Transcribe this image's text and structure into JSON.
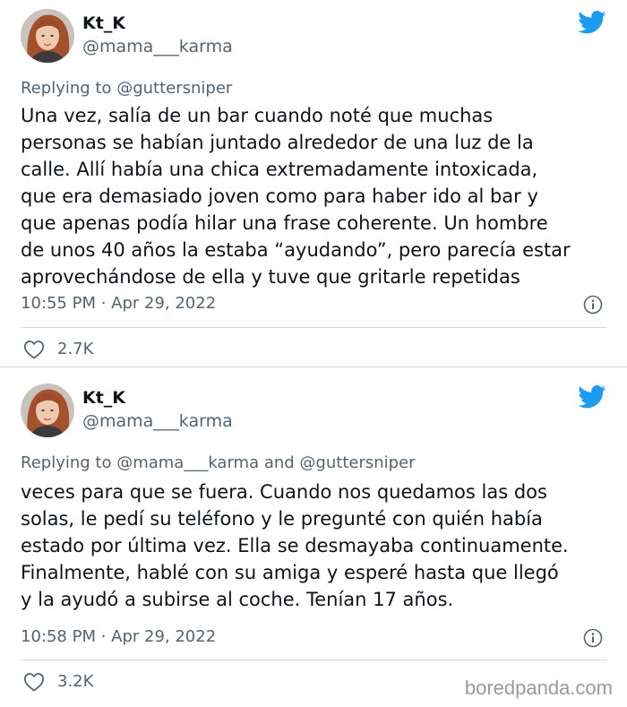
{
  "colors": {
    "text_primary": "#0f1419",
    "text_secondary": "#536471",
    "twitter_blue": "#1d9bf0",
    "divider": "#cfd9de"
  },
  "tweets": [
    {
      "author": {
        "display_name": "Kt_K",
        "handle": "@mama___karma",
        "avatar_icon": "avatar-photo"
      },
      "replying_to": "Replying to @guttersniper",
      "body_lines": [
        "Una vez, salía de un bar cuando noté que muchas",
        "personas se habían juntado alrededor de una luz de la",
        "calle. Allí había una chica extremadamente intoxicada,",
        "que era demasiado joven como para haber ido al bar y",
        "que apenas podía hilar una frase coherente. Un hombre",
        "de unos 40 años la estaba “ayudando”, pero parecía estar",
        "aprovechándose de ella y tuve que gritarle repetidas"
      ],
      "timestamp": "10:55 PM · Apr 29, 2022",
      "likes": "2.7K",
      "icons": [
        "twitter-bird-icon",
        "info-icon",
        "heart-icon"
      ]
    },
    {
      "author": {
        "display_name": "Kt_K",
        "handle": "@mama___karma",
        "avatar_icon": "avatar-photo"
      },
      "replying_to": "Replying to @mama___karma and @guttersniper",
      "body_lines": [
        "veces para que se fuera. Cuando nos quedamos las dos",
        "solas, le pedí su teléfono y le pregunté con quién había",
        "estado por última vez. Ella se desmayaba continuamente.",
        "Finalmente, hablé con su amiga y esperé hasta que llegó",
        "y la ayudó a subirse al coche. Tenían 17 años."
      ],
      "timestamp": "10:58 PM · Apr 29, 2022",
      "likes": "3.2K",
      "icons": [
        "twitter-bird-icon",
        "info-icon",
        "heart-icon"
      ]
    }
  ],
  "watermark": "boredpanda.com"
}
